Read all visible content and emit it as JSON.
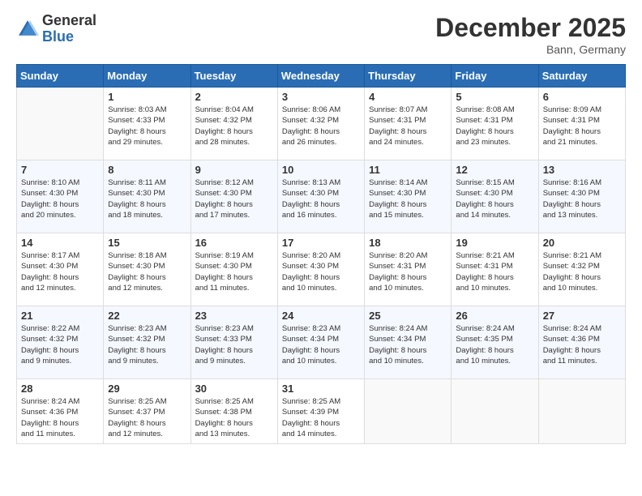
{
  "header": {
    "logo": {
      "general": "General",
      "blue": "Blue"
    },
    "title": "December 2025",
    "location": "Bann, Germany"
  },
  "calendar": {
    "days_of_week": [
      "Sunday",
      "Monday",
      "Tuesday",
      "Wednesday",
      "Thursday",
      "Friday",
      "Saturday"
    ],
    "weeks": [
      [
        {
          "day": "",
          "info": ""
        },
        {
          "day": "1",
          "info": "Sunrise: 8:03 AM\nSunset: 4:33 PM\nDaylight: 8 hours\nand 29 minutes."
        },
        {
          "day": "2",
          "info": "Sunrise: 8:04 AM\nSunset: 4:32 PM\nDaylight: 8 hours\nand 28 minutes."
        },
        {
          "day": "3",
          "info": "Sunrise: 8:06 AM\nSunset: 4:32 PM\nDaylight: 8 hours\nand 26 minutes."
        },
        {
          "day": "4",
          "info": "Sunrise: 8:07 AM\nSunset: 4:31 PM\nDaylight: 8 hours\nand 24 minutes."
        },
        {
          "day": "5",
          "info": "Sunrise: 8:08 AM\nSunset: 4:31 PM\nDaylight: 8 hours\nand 23 minutes."
        },
        {
          "day": "6",
          "info": "Sunrise: 8:09 AM\nSunset: 4:31 PM\nDaylight: 8 hours\nand 21 minutes."
        }
      ],
      [
        {
          "day": "7",
          "info": "Sunrise: 8:10 AM\nSunset: 4:30 PM\nDaylight: 8 hours\nand 20 minutes."
        },
        {
          "day": "8",
          "info": "Sunrise: 8:11 AM\nSunset: 4:30 PM\nDaylight: 8 hours\nand 18 minutes."
        },
        {
          "day": "9",
          "info": "Sunrise: 8:12 AM\nSunset: 4:30 PM\nDaylight: 8 hours\nand 17 minutes."
        },
        {
          "day": "10",
          "info": "Sunrise: 8:13 AM\nSunset: 4:30 PM\nDaylight: 8 hours\nand 16 minutes."
        },
        {
          "day": "11",
          "info": "Sunrise: 8:14 AM\nSunset: 4:30 PM\nDaylight: 8 hours\nand 15 minutes."
        },
        {
          "day": "12",
          "info": "Sunrise: 8:15 AM\nSunset: 4:30 PM\nDaylight: 8 hours\nand 14 minutes."
        },
        {
          "day": "13",
          "info": "Sunrise: 8:16 AM\nSunset: 4:30 PM\nDaylight: 8 hours\nand 13 minutes."
        }
      ],
      [
        {
          "day": "14",
          "info": "Sunrise: 8:17 AM\nSunset: 4:30 PM\nDaylight: 8 hours\nand 12 minutes."
        },
        {
          "day": "15",
          "info": "Sunrise: 8:18 AM\nSunset: 4:30 PM\nDaylight: 8 hours\nand 12 minutes."
        },
        {
          "day": "16",
          "info": "Sunrise: 8:19 AM\nSunset: 4:30 PM\nDaylight: 8 hours\nand 11 minutes."
        },
        {
          "day": "17",
          "info": "Sunrise: 8:20 AM\nSunset: 4:30 PM\nDaylight: 8 hours\nand 10 minutes."
        },
        {
          "day": "18",
          "info": "Sunrise: 8:20 AM\nSunset: 4:31 PM\nDaylight: 8 hours\nand 10 minutes."
        },
        {
          "day": "19",
          "info": "Sunrise: 8:21 AM\nSunset: 4:31 PM\nDaylight: 8 hours\nand 10 minutes."
        },
        {
          "day": "20",
          "info": "Sunrise: 8:21 AM\nSunset: 4:32 PM\nDaylight: 8 hours\nand 10 minutes."
        }
      ],
      [
        {
          "day": "21",
          "info": "Sunrise: 8:22 AM\nSunset: 4:32 PM\nDaylight: 8 hours\nand 9 minutes."
        },
        {
          "day": "22",
          "info": "Sunrise: 8:23 AM\nSunset: 4:32 PM\nDaylight: 8 hours\nand 9 minutes."
        },
        {
          "day": "23",
          "info": "Sunrise: 8:23 AM\nSunset: 4:33 PM\nDaylight: 8 hours\nand 9 minutes."
        },
        {
          "day": "24",
          "info": "Sunrise: 8:23 AM\nSunset: 4:34 PM\nDaylight: 8 hours\nand 10 minutes."
        },
        {
          "day": "25",
          "info": "Sunrise: 8:24 AM\nSunset: 4:34 PM\nDaylight: 8 hours\nand 10 minutes."
        },
        {
          "day": "26",
          "info": "Sunrise: 8:24 AM\nSunset: 4:35 PM\nDaylight: 8 hours\nand 10 minutes."
        },
        {
          "day": "27",
          "info": "Sunrise: 8:24 AM\nSunset: 4:36 PM\nDaylight: 8 hours\nand 11 minutes."
        }
      ],
      [
        {
          "day": "28",
          "info": "Sunrise: 8:24 AM\nSunset: 4:36 PM\nDaylight: 8 hours\nand 11 minutes."
        },
        {
          "day": "29",
          "info": "Sunrise: 8:25 AM\nSunset: 4:37 PM\nDaylight: 8 hours\nand 12 minutes."
        },
        {
          "day": "30",
          "info": "Sunrise: 8:25 AM\nSunset: 4:38 PM\nDaylight: 8 hours\nand 13 minutes."
        },
        {
          "day": "31",
          "info": "Sunrise: 8:25 AM\nSunset: 4:39 PM\nDaylight: 8 hours\nand 14 minutes."
        },
        {
          "day": "",
          "info": ""
        },
        {
          "day": "",
          "info": ""
        },
        {
          "day": "",
          "info": ""
        }
      ]
    ]
  }
}
